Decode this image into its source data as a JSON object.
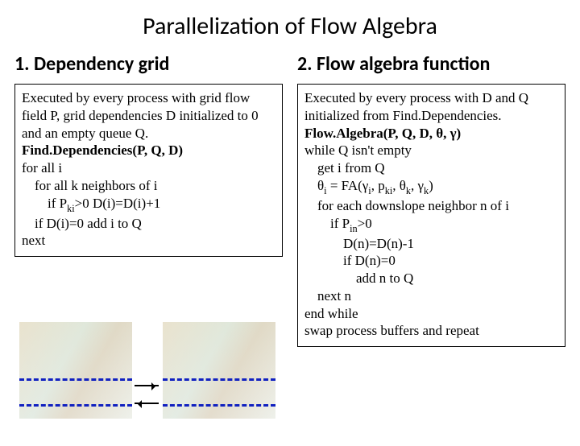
{
  "title": "Parallelization of Flow Algebra",
  "left": {
    "heading": "1. Dependency grid",
    "intro": "Executed by every process with grid flow field P, grid dependencies D initialized to 0 and an empty queue Q.",
    "fn": "Find.Dependencies(P, Q, D)",
    "for_i": "for all i",
    "for_k": "for all k neighbors of i",
    "if_p_pre": "if P",
    "if_p_sub": "ki",
    "if_p_post": ">0  D(i)=D(i)+1",
    "if_d": "if D(i)=0 add i to Q",
    "next": "next"
  },
  "right": {
    "heading": "2. Flow algebra function",
    "intro": "Executed by every process with D and Q initialized from Find.Dependencies.",
    "fn": "Flow.Algebra(P, Q, D, θ, γ)",
    "while": "while Q isn't empty",
    "get": "get i from Q",
    "theta_pre": "θ",
    "theta_sub_i": "i",
    "theta_eq": " = FA(γ",
    "theta_sub_i2": "i",
    "theta_comma_p": ", p",
    "theta_sub_ki": "ki",
    "theta_comma_th": ", θ",
    "theta_sub_k": "k",
    "theta_comma_g": ", γ",
    "theta_sub_k2": "k",
    "theta_close": ")",
    "for_n": "for each downslope neighbor n of i",
    "if_pin_pre": "if P",
    "if_pin_sub": "in",
    "if_pin_post": ">0",
    "dn": "D(n)=D(n)-1",
    "if_dn": "if D(n)=0",
    "add_n": "add n to Q",
    "next_n": "next n",
    "end_while": "end while",
    "swap": "swap process buffers and repeat"
  }
}
